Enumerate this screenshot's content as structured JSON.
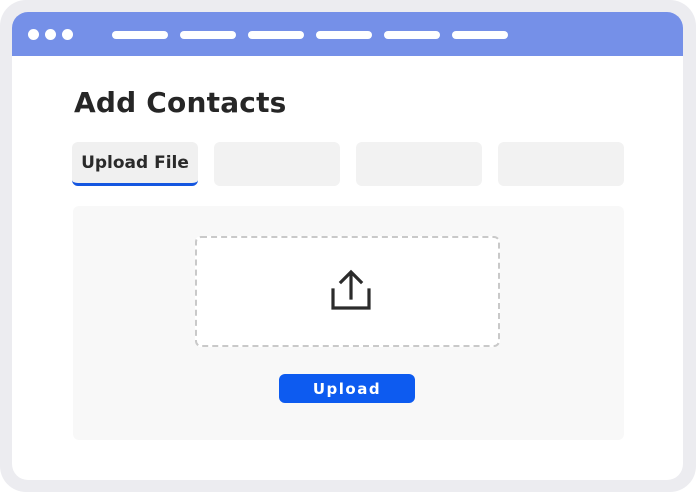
{
  "page": {
    "title": "Add Contacts"
  },
  "tabs": [
    {
      "label": "Upload File",
      "active": true
    },
    {
      "label": "",
      "active": false
    },
    {
      "label": "",
      "active": false
    },
    {
      "label": "",
      "active": false
    }
  ],
  "upload": {
    "icon": "upload-icon",
    "button_label": "Upload"
  },
  "colors": {
    "titlebar": "#7590e8",
    "accent": "#0d5bf0",
    "tab_underline": "#1456e0"
  }
}
